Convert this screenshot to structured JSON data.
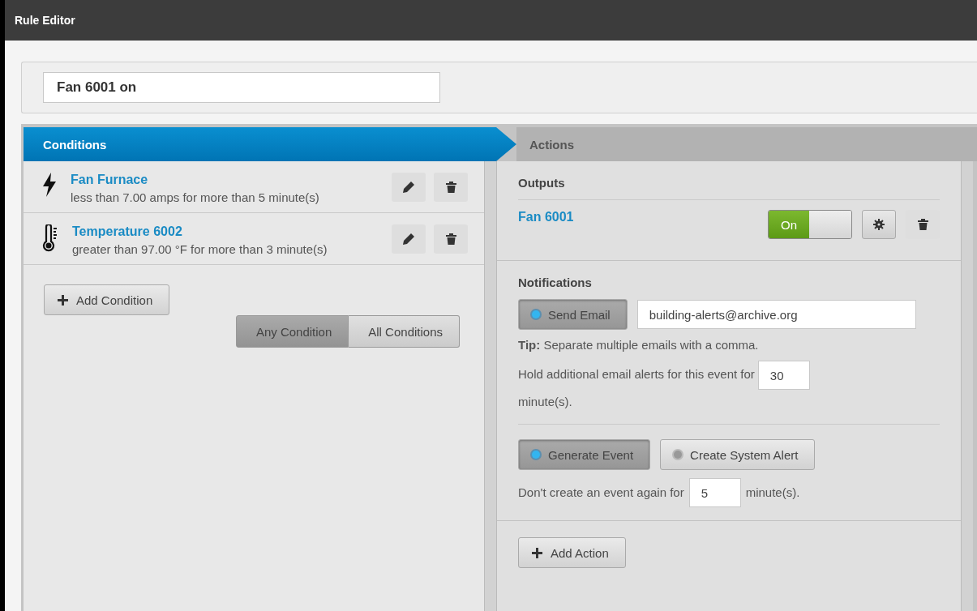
{
  "window": {
    "title": "Rule Editor"
  },
  "rule_name": {
    "value": "Fan 6001 on"
  },
  "steps": [
    {
      "label": "Conditions",
      "selected": true
    },
    {
      "label": "Actions",
      "selected": false
    }
  ],
  "conditions": [
    {
      "kind": "power",
      "name": "Fan Furnace",
      "description": "less than 7.00 amps for more than 5 minute(s)"
    },
    {
      "kind": "temperature",
      "name": "Temperature 6002",
      "description": "greater than 97.00 °F for more than 3 minute(s)"
    }
  ],
  "add_condition": "Add Condition",
  "match": [
    {
      "label": "Any Condition",
      "selected": true
    },
    {
      "label": "All Conditions",
      "selected": false
    }
  ],
  "outputs": {
    "heading": "Outputs",
    "items": [
      {
        "name": "Fan 6001",
        "switch_label": "On",
        "on": true
      }
    ]
  },
  "notifications": {
    "heading": "Notifications",
    "send_email": {
      "label": "Send Email",
      "selected": true
    },
    "email": "building-alerts@archive.org",
    "tip": "**Tip:** Separate multiple emails with a comma.",
    "hold_before": "Hold additional email alerts for this event for",
    "hold_value": "30",
    "hold_after": "minute(s).",
    "event_toggles": [
      {
        "label": "Generate Event",
        "selected": true
      },
      {
        "label": "Create System Alert",
        "selected": false
      }
    ],
    "repeat_before": "Don't create an event again for",
    "repeat_value": "5",
    "repeat_after": "minute(s)."
  },
  "add_action": "Add Action"
}
